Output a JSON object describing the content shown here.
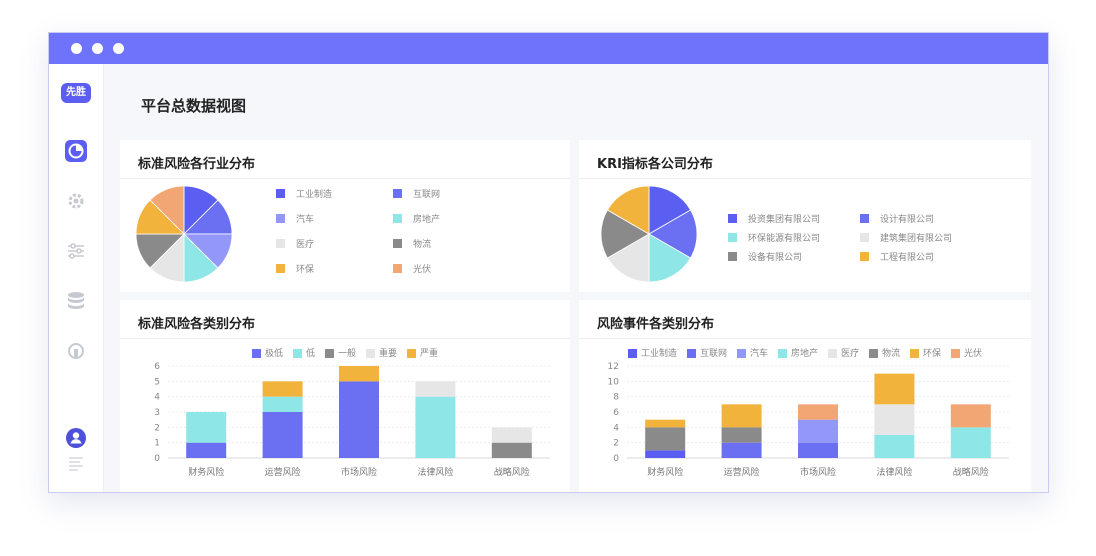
{
  "app": {
    "logo": "先胜"
  },
  "page": {
    "title": "平台总数据视图"
  },
  "sidebar": {
    "items": [
      {
        "icon": "pie-chart-icon",
        "active": true
      },
      {
        "icon": "gear-icon"
      },
      {
        "icon": "sliders-icon"
      },
      {
        "icon": "database-icon"
      },
      {
        "icon": "bulb-icon"
      }
    ],
    "bottom": [
      {
        "icon": "user-icon"
      },
      {
        "icon": "document-icon"
      }
    ]
  },
  "colors": {
    "accent": "#6f72fb",
    "工业制造": "#5a5ff2",
    "互联网": "#6b70f3",
    "汽车": "#9397f7",
    "房地产": "#8ee6e6",
    "医疗": "#e6e6e6",
    "物流": "#8a8a8a",
    "环保": "#f2b33d",
    "光伏": "#f2a673"
  },
  "panels": {
    "industry": {
      "title": "标准风险各行业分布",
      "chart_data": {
        "type": "pie",
        "labels": [
          "工业制造",
          "互联网",
          "汽车",
          "房地产",
          "医疗",
          "物流",
          "环保",
          "光伏"
        ],
        "values": [
          1,
          1,
          1,
          1,
          1,
          1,
          1,
          1
        ],
        "colors": [
          "#5a5ff2",
          "#6b70f3",
          "#9397f7",
          "#8ee6e6",
          "#e6e6e6",
          "#8a8a8a",
          "#f2b33d",
          "#f2a673"
        ]
      }
    },
    "kri": {
      "title": "KRI指标各公司分布",
      "chart_data": {
        "type": "pie",
        "labels": [
          "投资集团有限公司",
          "设计有限公司",
          "环保能源有限公司",
          "建筑集团有限公司",
          "设备有限公司",
          "工程有限公司"
        ],
        "values": [
          1,
          1,
          1,
          1,
          1,
          1
        ],
        "colors": [
          "#5a5ff2",
          "#6b70f3",
          "#8ee6e6",
          "#e6e6e6",
          "#8a8a8a",
          "#f2b33d"
        ]
      }
    },
    "category": {
      "title": "标准风险各类别分布",
      "chart_data": {
        "type": "bar",
        "stacked": true,
        "categories": [
          "财务风险",
          "运营风险",
          "市场风险",
          "法律风险",
          "战略风险"
        ],
        "series": [
          {
            "name": "极低",
            "color": "#6b70f3",
            "values": [
              1,
              3,
              5,
              0,
              0
            ]
          },
          {
            "name": "低",
            "color": "#8ee6e6",
            "values": [
              2,
              1,
              0,
              4,
              0
            ]
          },
          {
            "name": "一般",
            "color": "#8a8a8a",
            "values": [
              0,
              0,
              0,
              0,
              1
            ]
          },
          {
            "name": "重要",
            "color": "#e6e6e6",
            "values": [
              0,
              0,
              0,
              1,
              1
            ]
          },
          {
            "name": "严重",
            "color": "#f2b33d",
            "values": [
              0,
              1,
              1,
              0,
              0
            ]
          }
        ],
        "ylim": [
          0,
          6
        ],
        "yticks": [
          0,
          1,
          2,
          3,
          4,
          5,
          6
        ]
      }
    },
    "event": {
      "title": "风险事件各类别分布",
      "chart_data": {
        "type": "bar",
        "stacked": true,
        "categories": [
          "财务风险",
          "运营风险",
          "市场风险",
          "法律风险",
          "战略风险"
        ],
        "series": [
          {
            "name": "工业制造",
            "color": "#5a5ff2",
            "values": [
              1,
              0,
              0,
              0,
              0
            ]
          },
          {
            "name": "互联网",
            "color": "#6b70f3",
            "values": [
              0,
              2,
              2,
              0,
              0
            ]
          },
          {
            "name": "汽车",
            "color": "#9397f7",
            "values": [
              0,
              0,
              3,
              0,
              0
            ]
          },
          {
            "name": "房地产",
            "color": "#8ee6e6",
            "values": [
              0,
              0,
              0,
              3,
              4
            ]
          },
          {
            "name": "医疗",
            "color": "#e6e6e6",
            "values": [
              0,
              0,
              0,
              4,
              0
            ]
          },
          {
            "name": "物流",
            "color": "#8a8a8a",
            "values": [
              3,
              2,
              0,
              0,
              0
            ]
          },
          {
            "name": "环保",
            "color": "#f2b33d",
            "values": [
              1,
              3,
              0,
              4,
              0
            ]
          },
          {
            "name": "光伏",
            "color": "#f2a673",
            "values": [
              0,
              0,
              2,
              0,
              3
            ]
          }
        ],
        "ylim": [
          0,
          12
        ],
        "yticks": [
          0,
          2,
          4,
          6,
          8,
          10,
          12
        ]
      }
    }
  }
}
